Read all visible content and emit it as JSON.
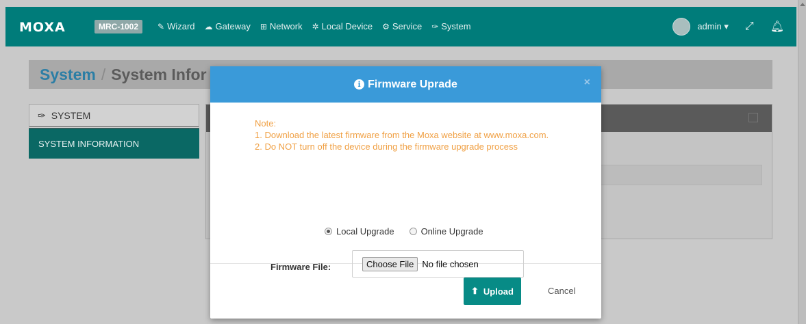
{
  "navbar": {
    "logo": "MOXA",
    "model": "MRC-1002",
    "menu": [
      {
        "icon": "wand-icon",
        "glyph": "✎",
        "label": "Wizard"
      },
      {
        "icon": "cloud-icon",
        "glyph": "☁",
        "label": "Gateway"
      },
      {
        "icon": "sitemap-icon",
        "glyph": "⊞",
        "label": "Network"
      },
      {
        "icon": "gear-icon",
        "glyph": "✲",
        "label": "Local Device"
      },
      {
        "icon": "cogs-icon",
        "glyph": "⚙",
        "label": "Service"
      },
      {
        "icon": "wrench-icon",
        "glyph": "✑",
        "label": "System"
      }
    ],
    "user": "admin"
  },
  "breadcrumb": {
    "root": "System",
    "separator": "/",
    "current": "System Infor"
  },
  "sidebar": {
    "header": "SYSTEM",
    "items": [
      {
        "label": "SYSTEM INFORMATION"
      }
    ]
  },
  "modal": {
    "title": "Firmware Uprade",
    "close": "×",
    "notes": [
      "Note:",
      "1. Download the latest firmware from the Moxa website at www.moxa.com.",
      "2. Do NOT turn off the device during the firmware upgrade process"
    ],
    "radio_local": "Local Upgrade",
    "radio_online": "Online Upgrade",
    "selected": "Local Upgrade",
    "file_label": "Firmware File:",
    "choose_button": "Choose File",
    "file_status": "No file chosen",
    "upload_label": "Upload",
    "cancel_label": "Cancel"
  },
  "colors": {
    "navbar": "#007c7a",
    "modal_header": "#3a9ad9",
    "note_text": "#f0a044",
    "upload_button": "#078b86"
  }
}
